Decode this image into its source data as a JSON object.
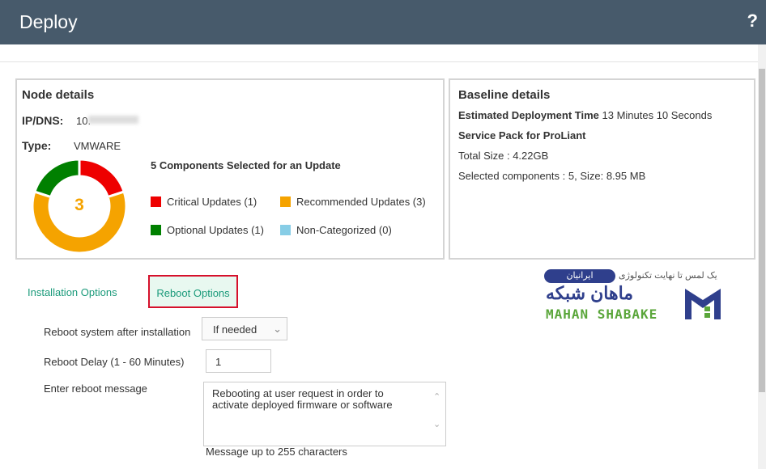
{
  "header": {
    "title": "Deploy",
    "help": "?"
  },
  "node": {
    "title": "Node details",
    "ip_label": "IP/DNS:",
    "ip_value": "10.",
    "type_label": "Type:",
    "type_value": "VMWARE",
    "summary": "5 Components Selected for an Update",
    "center_value": "3",
    "legend": [
      {
        "label": "Critical Updates (1)",
        "color": "#ee0000",
        "count": 1
      },
      {
        "label": "Recommended Updates (3)",
        "color": "#f5a300",
        "count": 3
      },
      {
        "label": "Optional Updates (1)",
        "color": "#008000",
        "count": 1
      },
      {
        "label": "Non-Categorized (0)",
        "color": "#87cde6",
        "count": 0
      }
    ]
  },
  "baseline": {
    "title": "Baseline details",
    "time_label": "Estimated Deployment Time",
    "time_value": "13 Minutes 10 Seconds",
    "pack": "Service Pack for ProLiant",
    "size": "Total Size : 4.22GB",
    "selected": "Selected components : 5, Size: 8.95 MB"
  },
  "tabs": [
    {
      "label": "Installation Options"
    },
    {
      "label": "Reboot Options",
      "active": true
    }
  ],
  "form": {
    "reboot_label": "Reboot system after installation",
    "reboot_value": "If needed",
    "delay_label": "Reboot Delay (1 - 60 Minutes)",
    "delay_value": "1",
    "message_label": "Enter reboot message",
    "message_value": "Rebooting at user request in order to activate deployed firmware or software",
    "hint": "Message up to 255 characters"
  },
  "watermark": {
    "tagline": "یک لمس تا نهایت تکنولوژی",
    "badge": "ایرانیان",
    "name_fa": "ماهان شبکه",
    "name_en": "MAHAN SHABAKE"
  }
}
